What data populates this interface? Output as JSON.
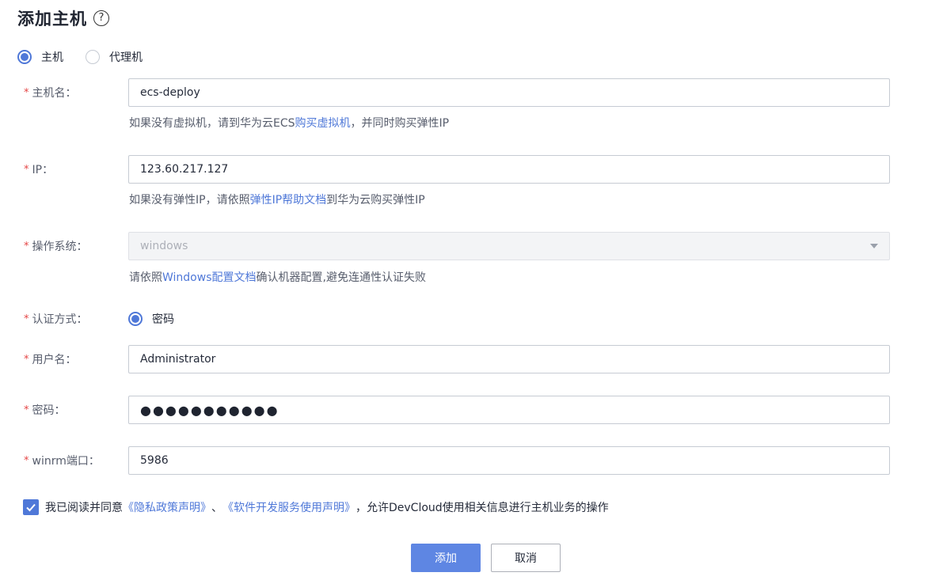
{
  "page": {
    "title": "添加主机",
    "help_icon": "?"
  },
  "host_type": {
    "options": [
      {
        "label": "主机",
        "checked": true
      },
      {
        "label": "代理机",
        "checked": false
      }
    ]
  },
  "form": {
    "required_mark": "*",
    "hostname": {
      "label": "主机名：",
      "value": "ecs-deploy",
      "hint_before": "如果没有虚拟机，请到华为云ECS ",
      "hint_link": "购买虚拟机",
      "hint_after": " ，并同时购买弹性IP"
    },
    "ip": {
      "label": "IP：",
      "value": "123.60.217.127",
      "hint_before": "如果没有弹性IP，请依照 ",
      "hint_link": "弹性IP帮助文档",
      "hint_after": " 到华为云购买弹性IP"
    },
    "os": {
      "label": "操作系统：",
      "value": "windows",
      "hint_before": "请依照 ",
      "hint_link": "Windows配置文档",
      "hint_after": " 确认机器配置,避免连通性认证失败"
    },
    "auth": {
      "label": "认证方式：",
      "option": "密码"
    },
    "username": {
      "label": "用户名：",
      "value": "Administrator"
    },
    "password": {
      "label": "密码：",
      "masked_value": "●●●●●●●●●●●"
    },
    "winrm_port": {
      "label": "winrm端口：",
      "value": "5986"
    }
  },
  "agreement": {
    "checked": true,
    "text_before": "我已阅读并同意",
    "link_privacy": "《隐私政策声明》",
    "separator": "、",
    "link_service": "《软件开发服务使用声明》",
    "text_after": "，允许DevCloud使用相关信息进行主机业务的操作"
  },
  "buttons": {
    "add": "添加",
    "cancel": "取消"
  },
  "colors": {
    "primary": "#5e86e3",
    "link": "#4f78d8",
    "required": "#e54545"
  }
}
